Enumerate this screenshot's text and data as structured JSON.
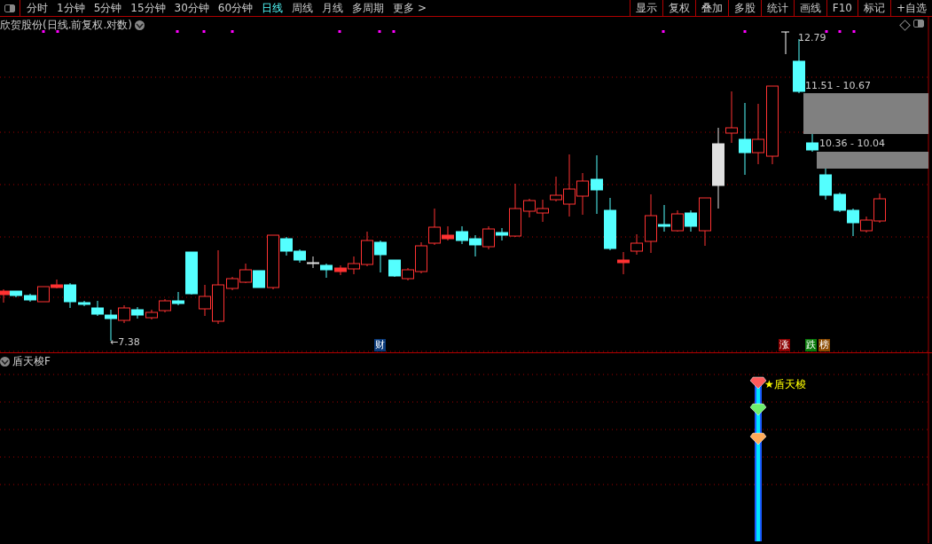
{
  "toolbar": {
    "periods": [
      {
        "label": "分时",
        "selected": false
      },
      {
        "label": "1分钟",
        "selected": false
      },
      {
        "label": "5分钟",
        "selected": false
      },
      {
        "label": "15分钟",
        "selected": false
      },
      {
        "label": "30分钟",
        "selected": false
      },
      {
        "label": "60分钟",
        "selected": false
      },
      {
        "label": "日线",
        "selected": true
      },
      {
        "label": "周线",
        "selected": false
      },
      {
        "label": "月线",
        "selected": false
      },
      {
        "label": "多周期",
        "selected": false
      },
      {
        "label": "更多 >",
        "selected": false
      }
    ],
    "actions": [
      "显示",
      "复权",
      "叠加",
      "多股",
      "统计",
      "画线",
      "F10",
      "标记",
      "+自选"
    ]
  },
  "main_chart": {
    "title": "欣贺股份(日线.前复权.对数)",
    "high_label": "12.79",
    "low_label": "←7.38",
    "zones": [
      {
        "label": "11.51 - 10.67"
      },
      {
        "label": "10.36 - 10.04"
      }
    ],
    "badges": [
      {
        "text": "财",
        "color": "#0a3a7a"
      },
      {
        "text": "涨",
        "color": "#8b0000"
      },
      {
        "text": "跌",
        "color": "#0a7a0a"
      },
      {
        "text": "榜",
        "color": "#8b4a00"
      }
    ]
  },
  "indicator": {
    "name": "盾天梭F",
    "signal": "★盾天梭"
  }
}
